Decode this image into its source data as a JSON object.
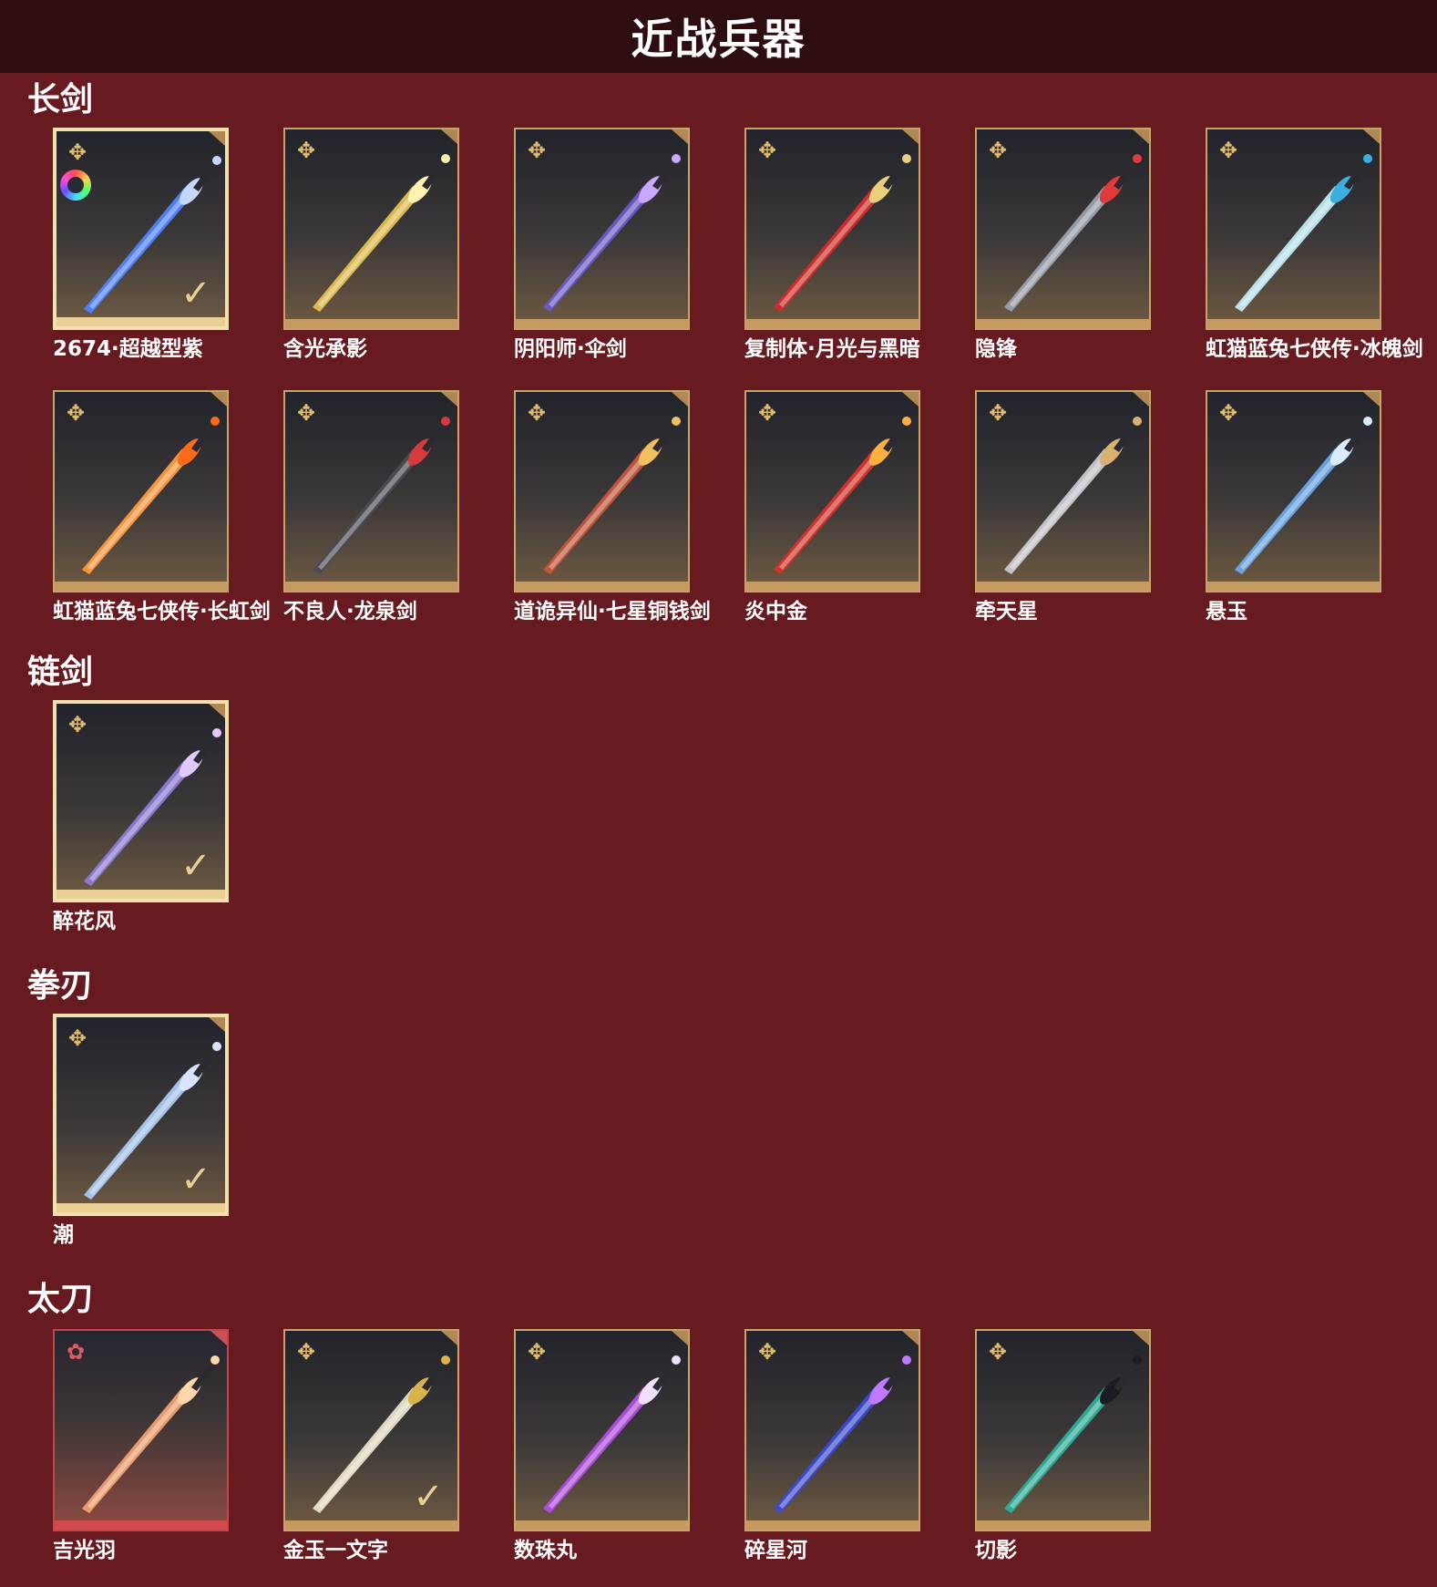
{
  "page_title": "近战兵器",
  "sections": [
    {
      "title": "长剑",
      "items": [
        {
          "name": "2674·超越型紫",
          "selected": true,
          "equipped": true,
          "has_dye": true,
          "color": "#4f83ff",
          "accent": "#c4d8ff"
        },
        {
          "name": "含光承影",
          "color": "#e4c04f",
          "accent": "#fff2b0"
        },
        {
          "name": "阴阳师·伞剑",
          "color": "#6c58c8",
          "accent": "#c9a8ff"
        },
        {
          "name": "复制体·月光与黑暗",
          "color": "#d62a2a",
          "accent": "#e8d07a"
        },
        {
          "name": "隐锋",
          "color": "#9aa0ad",
          "accent": "#e23a3a"
        },
        {
          "name": "虹猫蓝兔七侠传·冰魄剑",
          "color": "#bfe9f2",
          "accent": "#3bb0e0"
        },
        {
          "name": "虹猫蓝兔七侠传·长虹剑",
          "color": "#ff9a3c",
          "accent": "#ff6a1a"
        },
        {
          "name": "不良人·龙泉剑",
          "color": "#4a4a52",
          "accent": "#d63a3a"
        },
        {
          "name": "道诡异仙·七星铜钱剑",
          "color": "#c6553a",
          "accent": "#f0c060"
        },
        {
          "name": "炎中金",
          "color": "#d8322a",
          "accent": "#ffb040"
        },
        {
          "name": "牵天星",
          "color": "#c9c9cf",
          "accent": "#d8b270"
        },
        {
          "name": "悬玉",
          "color": "#6aa8e8",
          "accent": "#d8ecff"
        }
      ]
    },
    {
      "title": "链剑",
      "items": [
        {
          "name": "醉花风",
          "selected": true,
          "equipped": true,
          "color": "#8e7ad6",
          "accent": "#e2c8ff"
        }
      ]
    },
    {
      "title": "拳刃",
      "items": [
        {
          "name": "潮",
          "selected": true,
          "equipped": true,
          "color": "#a8c8f0",
          "accent": "#d8e4ff"
        }
      ]
    },
    {
      "title": "太刀",
      "items": [
        {
          "name": "吉光羽",
          "rarity": "red",
          "color": "#f0a070",
          "accent": "#ffd7a8"
        },
        {
          "name": "金玉一文字",
          "equipped": true,
          "color": "#e8e0c8",
          "accent": "#d8b44a"
        },
        {
          "name": "数珠丸",
          "color": "#b14de0",
          "accent": "#f0e0ff"
        },
        {
          "name": "碎星河",
          "color": "#3a4ad0",
          "accent": "#c07aff"
        },
        {
          "name": "切影",
          "color": "#2ab09a",
          "accent": "#1c1c24"
        }
      ]
    }
  ]
}
